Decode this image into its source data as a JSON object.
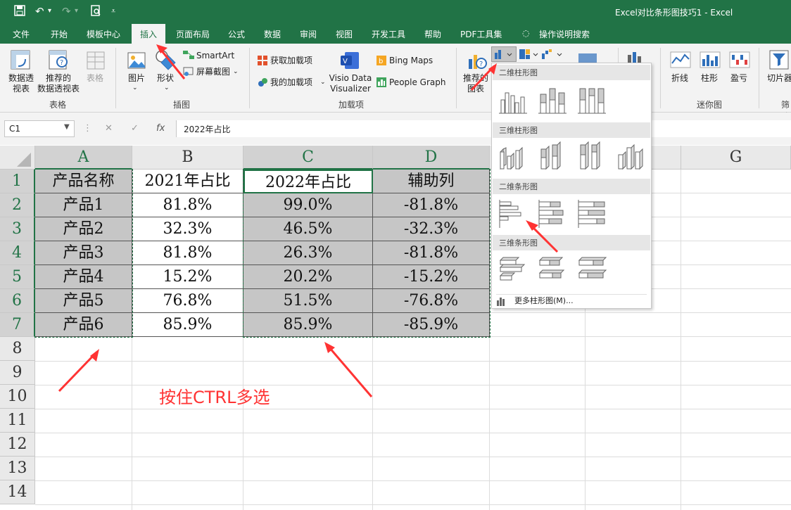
{
  "window": {
    "title": "Excel对比条形图技巧1 - Excel"
  },
  "qa_icons": [
    "save-icon",
    "undo-icon",
    "redo-icon",
    "print-preview-icon",
    "customize-icon"
  ],
  "menu": {
    "tabs": [
      "文件",
      "开始",
      "模板中心",
      "插入",
      "页面布局",
      "公式",
      "数据",
      "审阅",
      "视图",
      "开发工具",
      "帮助",
      "PDF工具集",
      "操作说明搜索"
    ],
    "active": "插入"
  },
  "ribbon": {
    "table_group": {
      "label": "表格",
      "pivot": "数据透视表",
      "pivot_l1": "数据透",
      "pivot_l2": "视表",
      "recommended": "推荐的数据透视表",
      "recommended_l1": "推荐的",
      "recommended_l2": "数据透视表",
      "table": "表格"
    },
    "illus_group": {
      "label": "插图",
      "pictures": "图片",
      "shapes": "形状",
      "smartart": "SmartArt",
      "screenshot": "屏幕截图"
    },
    "addins_group": {
      "label": "加载项",
      "get": "获取加载项",
      "my": "我的加载项",
      "visio": "Visio Data Visualizer",
      "visio_l1": "Visio Data",
      "visio_l2": "Visualizer",
      "bing": "Bing Maps",
      "people": "People Graph"
    },
    "charts_group": {
      "recommended": "推荐的图表",
      "rec_l1": "推荐的",
      "rec_l2": "图表"
    },
    "sparklines_group": {
      "label": "迷你图",
      "line": "折线",
      "column": "柱形",
      "winloss": "盈亏"
    },
    "filters_group": {
      "slicer": "切片器",
      "label": "筛选"
    }
  },
  "formula_bar": {
    "name_box": "C1",
    "content": "2022年占比"
  },
  "columns": [
    "A",
    "B",
    "C",
    "D",
    "E",
    "F",
    "G"
  ],
  "rows": [
    "1",
    "2",
    "3",
    "4",
    "5",
    "6",
    "7",
    "8",
    "9",
    "10",
    "11",
    "12",
    "13",
    "14"
  ],
  "table": {
    "headers": [
      "产品名称",
      "2021年占比",
      "2022年占比",
      "辅助列"
    ],
    "rows": [
      [
        "产品1",
        "81.8%",
        "99.0%",
        "-81.8%"
      ],
      [
        "产品2",
        "32.3%",
        "46.5%",
        "-32.3%"
      ],
      [
        "产品3",
        "81.8%",
        "26.3%",
        "-81.8%"
      ],
      [
        "产品4",
        "15.2%",
        "20.2%",
        "-15.2%"
      ],
      [
        "产品5",
        "76.8%",
        "51.5%",
        "-76.8%"
      ],
      [
        "产品6",
        "85.9%",
        "85.9%",
        "-85.9%"
      ]
    ]
  },
  "chart_dropdown": {
    "sections": [
      "二维柱形图",
      "三维柱形图",
      "二维条形图",
      "三维条形图"
    ],
    "more": "更多柱形图(M)..."
  },
  "annotation": "按住CTRL多选",
  "colors": {
    "excel_green": "#217346",
    "annotation_red": "#ff3333",
    "selection_gray": "#c6c6c6"
  }
}
